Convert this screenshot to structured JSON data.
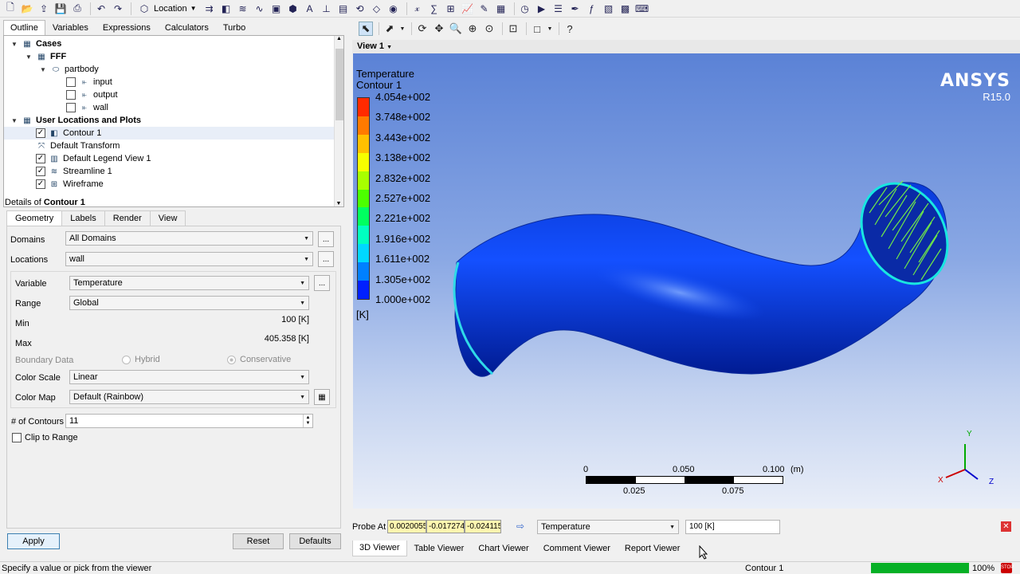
{
  "toolbar": {
    "location_label": "Location",
    "icons": [
      "new-icon",
      "open-icon",
      "load-icon",
      "save-icon",
      "print-icon",
      "undo-icon",
      "redo-icon",
      "location-icon",
      "vector-icon",
      "contour-icon",
      "streamline-icon",
      "particle-track-icon",
      "volume-icon",
      "isosurface-icon",
      "text-icon",
      "coordinate-frame-icon",
      "legend-icon",
      "instance-transform-icon",
      "clip-plane-icon",
      "color-map-icon",
      "variable-icon",
      "expression-icon",
      "table-icon",
      "chart-icon",
      "comment-icon",
      "figure-icon",
      "time-step-icon",
      "animation-icon",
      "quick-editor-icon",
      "probe-icon",
      "function-calc-icon",
      "macro-icon",
      "command-icon"
    ]
  },
  "outline": {
    "tabs": [
      "Outline",
      "Variables",
      "Expressions",
      "Calculators",
      "Turbo"
    ],
    "tree": [
      {
        "label": "Cases",
        "level": 0,
        "bold": true,
        "expand": "▼",
        "checkbox": null,
        "icon": "cases-icon"
      },
      {
        "label": "FFF",
        "level": 1,
        "bold": true,
        "expand": "▼",
        "checkbox": null,
        "icon": "case-fff-icon"
      },
      {
        "label": "partbody",
        "level": 2,
        "bold": false,
        "expand": "▼",
        "checkbox": null,
        "icon": "domain-icon"
      },
      {
        "label": "input",
        "level": 3,
        "bold": false,
        "expand": "",
        "checkbox": false,
        "icon": "boundary-icon"
      },
      {
        "label": "output",
        "level": 3,
        "bold": false,
        "expand": "",
        "checkbox": false,
        "icon": "boundary-icon"
      },
      {
        "label": "wall",
        "level": 3,
        "bold": false,
        "expand": "",
        "checkbox": false,
        "icon": "boundary-icon"
      },
      {
        "label": "User Locations and Plots",
        "level": 0,
        "bold": true,
        "expand": "▼",
        "checkbox": null,
        "icon": "user-locations-icon"
      },
      {
        "label": "Contour 1",
        "level": 1,
        "bold": false,
        "expand": "",
        "checkbox": true,
        "icon": "contour-icon",
        "selected": true
      },
      {
        "label": "Default Transform",
        "level": 1,
        "bold": false,
        "expand": "",
        "checkbox": null,
        "icon": "transform-icon"
      },
      {
        "label": "Default Legend View 1",
        "level": 1,
        "bold": false,
        "expand": "",
        "checkbox": true,
        "icon": "legend-icon"
      },
      {
        "label": "Streamline 1",
        "level": 1,
        "bold": false,
        "expand": "",
        "checkbox": true,
        "icon": "streamline-icon"
      },
      {
        "label": "Wireframe",
        "level": 1,
        "bold": false,
        "expand": "",
        "checkbox": true,
        "icon": "wireframe-icon"
      }
    ]
  },
  "details": {
    "title_prefix": "Details of ",
    "title_object": "Contour 1",
    "tabs": [
      "Geometry",
      "Labels",
      "Render",
      "View"
    ],
    "domains_label": "Domains",
    "domains_value": "All Domains",
    "locations_label": "Locations",
    "locations_value": "wall",
    "variable_label": "Variable",
    "variable_value": "Temperature",
    "range_label": "Range",
    "range_value": "Global",
    "min_label": "Min",
    "min_value": "100 [K]",
    "max_label": "Max",
    "max_value": "405.358 [K]",
    "boundary_label": "Boundary Data",
    "hybrid_label": "Hybrid",
    "conservative_label": "Conservative",
    "color_scale_label": "Color Scale",
    "color_scale_value": "Linear",
    "color_map_label": "Color Map",
    "color_map_value": "Default (Rainbow)",
    "contours_label": "# of Contours",
    "contours_value": "11",
    "clip_label": "Clip to Range",
    "dots": "...",
    "apply": "Apply",
    "reset": "Reset",
    "defaults": "Defaults"
  },
  "viewer": {
    "view_name": "View 1",
    "legend_title": "Temperature",
    "legend_subtitle": "Contour 1",
    "legend_unit": "[K]",
    "legend_ticks": [
      "4.054e+002",
      "3.748e+002",
      "3.443e+002",
      "3.138e+002",
      "2.832e+002",
      "2.527e+002",
      "2.221e+002",
      "1.916e+002",
      "1.611e+002",
      "1.305e+002",
      "1.000e+002"
    ],
    "colormap": [
      "#ff2a00",
      "#ff7a00",
      "#ffc000",
      "#f6ff00",
      "#a8ff00",
      "#4cff00",
      "#00ff60",
      "#00ffc0",
      "#00d8ff",
      "#0080ff",
      "#0020ff"
    ],
    "brand": "ANSYS",
    "version": "R15.0",
    "scale_top": [
      "0",
      "0.050",
      "0.100",
      "(m)"
    ],
    "scale_bottom": [
      "0.025",
      "0.075"
    ],
    "axis_labels": [
      "Y",
      "X",
      "Z"
    ]
  },
  "probe": {
    "label": "Probe At",
    "x": "0.0020055",
    "y": "-0.017274",
    "z": "-0.024115",
    "variable": "Temperature",
    "result": "100 [K]"
  },
  "bottom_tabs": [
    "3D Viewer",
    "Table Viewer",
    "Chart Viewer",
    "Comment Viewer",
    "Report Viewer"
  ],
  "status": {
    "hint": "Specify a value or pick from the viewer",
    "object": "Contour 1",
    "progress_percent": 100,
    "progress_label": "100%"
  }
}
